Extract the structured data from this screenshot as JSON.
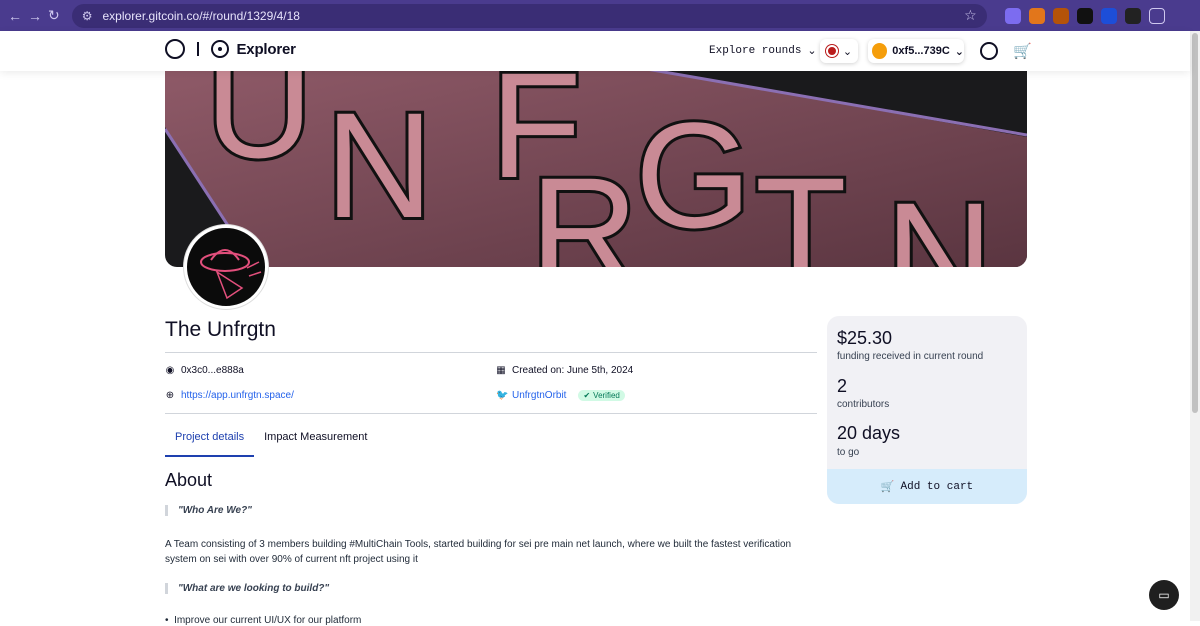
{
  "browser": {
    "url": "explorer.gitcoin.co/#/round/1329/4/18"
  },
  "header": {
    "brand": "Explorer",
    "explore_rounds": "Explore rounds",
    "wallet": "0xf5...739C"
  },
  "banner": {
    "letters": "UNFRGTN"
  },
  "project": {
    "title": "The Unfrgtn",
    "address": "0x3c0...e888a",
    "created": "Created on: June 5th, 2024",
    "website": "https://app.unfrgtn.space/",
    "twitter": "UnfrgtnOrbit",
    "verified": "Verified"
  },
  "tabs": [
    {
      "label": "Project details",
      "active": true
    },
    {
      "label": "Impact Measurement",
      "active": false
    }
  ],
  "about": {
    "title": "About",
    "quote1": "\"Who Are We?\"",
    "para1": "A Team consisting of 3 members building #MultiChain Tools, started building for sei pre main net launch, where we built the fastest verification system on sei with over 90% of current nft project using it",
    "quote2": "\"What are we looking to build?\"",
    "bullet1": "Improve our current UI/UX for our platform"
  },
  "side": {
    "amount": "$25.30",
    "amount_label": "funding received in current round",
    "contributors": "2",
    "contributors_label": "contributors",
    "days": "20 days",
    "days_label": "to go",
    "add_to_cart": "Add to cart"
  },
  "colors": {
    "browser_chrome": "#4a3b8e",
    "accent_blue": "#1e40af",
    "cart_button": "#d6ecfb",
    "card_bg": "#f1f1f5",
    "banner_pink": "#c98a95"
  }
}
